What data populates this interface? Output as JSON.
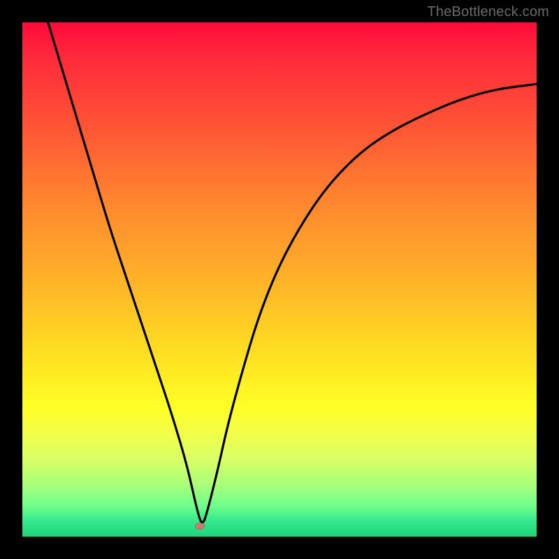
{
  "watermark": "TheBottleneck.com",
  "chart_data": {
    "type": "line",
    "title": "",
    "xlabel": "",
    "ylabel": "",
    "xlim": [
      0,
      100
    ],
    "ylim": [
      0,
      100
    ],
    "grid": false,
    "legend": null,
    "marker": {
      "x": 34.5,
      "y": 2,
      "shape": "ellipse",
      "color": "#cc7a6f"
    },
    "background_gradient_stops": [
      {
        "pos": 0,
        "color": "#ff0a3a"
      },
      {
        "pos": 22,
        "color": "#ff5a34"
      },
      {
        "pos": 50,
        "color": "#ffb228"
      },
      {
        "pos": 75,
        "color": "#ffff26"
      },
      {
        "pos": 90,
        "color": "#a8ff7a"
      },
      {
        "pos": 100,
        "color": "#1ed47a"
      }
    ],
    "series": [
      {
        "name": "curve",
        "x": [
          5,
          8,
          11,
          14,
          17,
          20,
          23,
          26,
          29,
          32,
          34,
          35,
          36,
          38,
          40,
          43,
          46,
          50,
          55,
          60,
          66,
          72,
          78,
          85,
          92,
          100
        ],
        "y": [
          100,
          90,
          80,
          70,
          60,
          51,
          42,
          33,
          24,
          14,
          5,
          2,
          5,
          13,
          22,
          33,
          43,
          53,
          62,
          69,
          75,
          79,
          82,
          85,
          87,
          88
        ]
      }
    ]
  }
}
